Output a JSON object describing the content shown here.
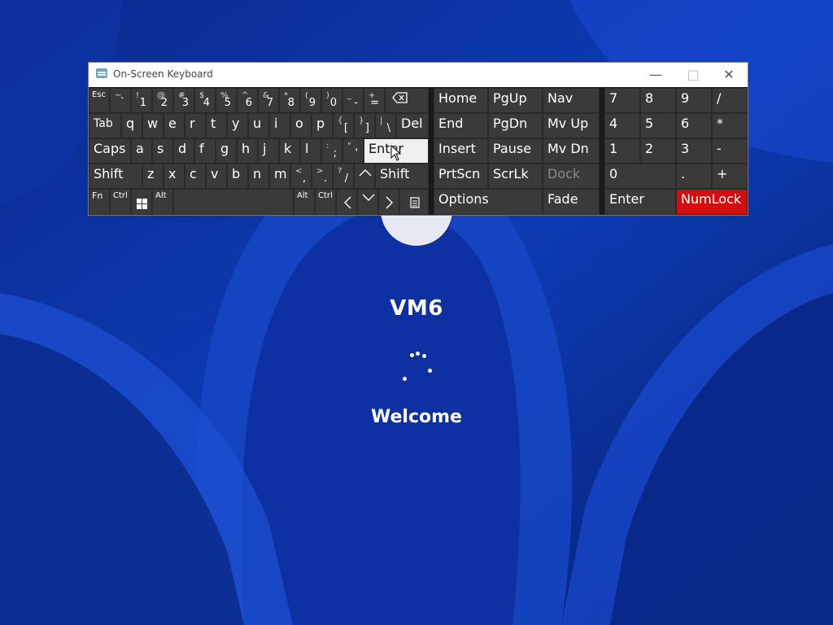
{
  "window": {
    "title": "On-Screen Keyboard",
    "icons": {
      "app": "keyboard-app-icon",
      "minimize": "minimize-icon",
      "maximize": "maximize-icon",
      "close": "close-icon"
    }
  },
  "login": {
    "username": "VM6",
    "status": "Welcome"
  },
  "colors": {
    "wallpaper": "#0b2f9c",
    "key_bg": "#3a3a3a",
    "key_highlight": "#f0f0f0",
    "numlock_active": "#d10f0f"
  },
  "keys": {
    "esc": "Esc",
    "backtick": {
      "top": "~",
      "bottom": "`"
    },
    "d1": {
      "top": "!",
      "bottom": "1"
    },
    "d2": {
      "top": "@",
      "bottom": "2"
    },
    "d3": {
      "top": "#",
      "bottom": "3"
    },
    "d4": {
      "top": "$",
      "bottom": "4"
    },
    "d5": {
      "top": "%",
      "bottom": "5"
    },
    "d6": {
      "top": "^",
      "bottom": "6"
    },
    "d7": {
      "top": "&",
      "bottom": "7"
    },
    "d8": {
      "top": "*",
      "bottom": "8"
    },
    "d9": {
      "top": "(",
      "bottom": "9"
    },
    "d0": {
      "top": ")",
      "bottom": "0"
    },
    "minus": {
      "top": "_",
      "bottom": "-"
    },
    "equals": {
      "top": "+",
      "bottom": "="
    },
    "backspace_icon": "backspace-icon",
    "tab": "Tab",
    "q": "q",
    "w": "w",
    "e": "e",
    "r": "r",
    "t": "t",
    "y": "y",
    "u": "u",
    "i": "i",
    "o": "o",
    "p": "p",
    "lbracket": {
      "top": "{",
      "bottom": "["
    },
    "rbracket": {
      "top": "}",
      "bottom": "]"
    },
    "backslash": {
      "top": "|",
      "bottom": "\\"
    },
    "del": "Del",
    "caps": "Caps",
    "a": "a",
    "s": "s",
    "d": "d",
    "f": "f",
    "g": "g",
    "h": "h",
    "j": "j",
    "k": "k",
    "l": "l",
    "semicolon": {
      "top": ":",
      "bottom": ";"
    },
    "quote": {
      "top": "\"",
      "bottom": "'"
    },
    "enter": "Enter",
    "shift_left": "Shift",
    "z": "z",
    "x": "x",
    "c": "c",
    "v": "v",
    "b": "b",
    "n": "n",
    "m": "m",
    "comma": {
      "top": "<",
      "bottom": ","
    },
    "period": {
      "top": ">",
      "bottom": "."
    },
    "slash": {
      "top": "?",
      "bottom": "/"
    },
    "shift_right": "Shift",
    "fn": "Fn",
    "ctrl": "Ctrl",
    "alt": "Alt",
    "home": "Home",
    "pgup": "PgUp",
    "nav": "Nav",
    "end": "End",
    "pgdn": "PgDn",
    "mvup": "Mv Up",
    "insert": "Insert",
    "pause": "Pause",
    "mvdn": "Mv Dn",
    "prtscn": "PrtScn",
    "scrlk": "ScrLk",
    "dock": "Dock",
    "options": "Options",
    "fade": "Fade",
    "np7": "7",
    "np8": "8",
    "np9": "9",
    "npdiv": "/",
    "np4": "4",
    "np5": "5",
    "np6": "6",
    "npmul": "*",
    "np1": "1",
    "np2": "2",
    "np3": "3",
    "npsub": "-",
    "np0": "0",
    "npdot": ".",
    "npadd": "+",
    "npenter": "Enter",
    "numlock": "NumLock"
  }
}
